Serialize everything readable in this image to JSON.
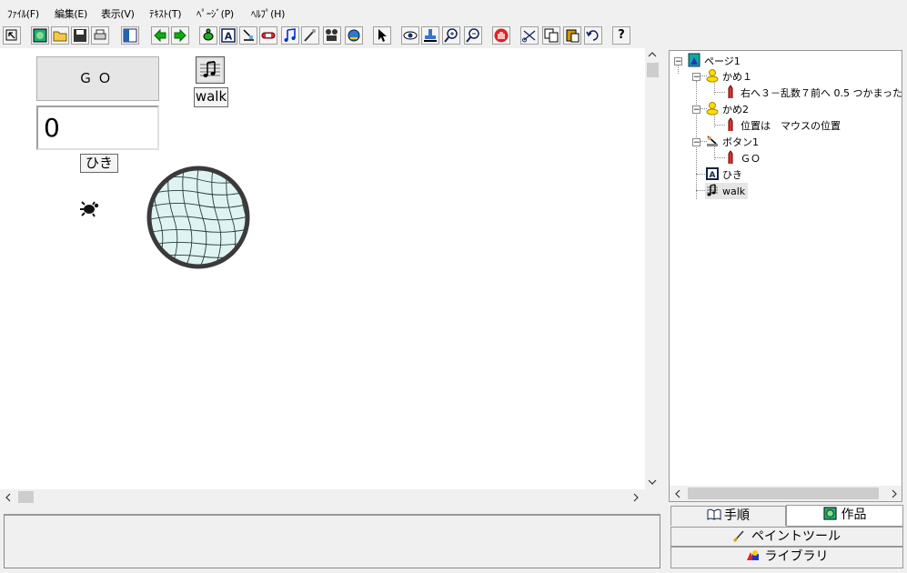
{
  "menu": [
    "ﾌｧｲﾙ(F)",
    "編集(E)",
    "表示(V)",
    "ﾃｷｽﾄ(T)",
    "ﾍﾟｰｼﾞ(P)",
    "ﾍﾙﾌﾟ(H)"
  ],
  "toolbar": {
    "help_label": "?"
  },
  "stage": {
    "go_button_label": "ＧＯ",
    "count_value": "0",
    "count_label": "ひき",
    "sound_label": "walk"
  },
  "tree": {
    "page": "ページ1",
    "turtle1": "かめ１",
    "turtle1_script": "右へ３－乱数７前へ 0.5 つかまった",
    "turtle2": "かめ2",
    "turtle2_script": "位置は　マウスの位置",
    "button": "ボタン1",
    "button_script": "ＧＯ",
    "text_obj": "ひき",
    "sound_obj": "walk"
  },
  "tabs": {
    "procedure": "手順",
    "works": "作品",
    "paint_tool": "ペイントツール",
    "library": "ライブラリ"
  },
  "colors": {
    "background": "#f0f0f0",
    "canvas": "#ffffff",
    "net": "#dff3f3",
    "net_rim": "#3a3a3a"
  }
}
